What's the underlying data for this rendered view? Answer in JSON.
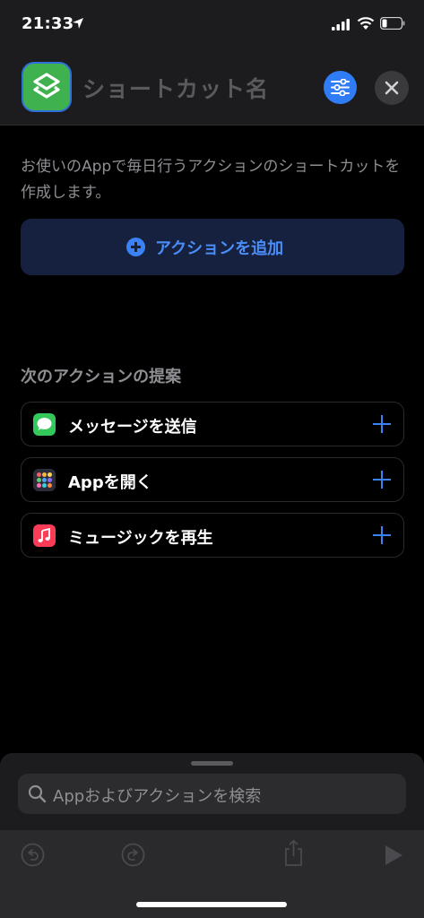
{
  "status": {
    "time": "21:33"
  },
  "header": {
    "title": "ショートカット名"
  },
  "description": "お使いのAppで毎日行うアクションのショートカットを作成します。",
  "add_action_label": "アクションを追加",
  "suggestions_title": "次のアクションの提案",
  "suggestions": [
    {
      "label": "メッセージを送信",
      "icon": "messages-icon"
    },
    {
      "label": "Appを開く",
      "icon": "app-grid-icon"
    },
    {
      "label": "ミュージックを再生",
      "icon": "music-icon"
    }
  ],
  "search": {
    "placeholder": "Appおよびアクションを検索"
  },
  "colors": {
    "accent": "#3b82f6",
    "shortcut_icon": "#3fb24f"
  }
}
